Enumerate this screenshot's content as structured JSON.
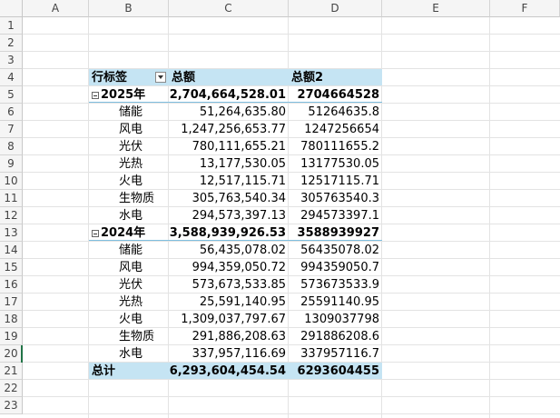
{
  "columns": [
    "A",
    "B",
    "C",
    "D",
    "E",
    "F"
  ],
  "rows": [
    "1",
    "2",
    "3",
    "4",
    "5",
    "6",
    "7",
    "8",
    "9",
    "10",
    "11",
    "12",
    "13",
    "14",
    "15",
    "16",
    "17",
    "18",
    "19",
    "20",
    "21",
    "22",
    "23"
  ],
  "pivot": {
    "header": {
      "label": "行标签",
      "col_c": "总额",
      "col_d": "总额2"
    },
    "groups": [
      {
        "label": "2025年",
        "total_c": "2,704,664,528.01",
        "total_d": "2704664528",
        "items": [
          {
            "label": "储能",
            "c": "51,264,635.80",
            "d": "51264635.8"
          },
          {
            "label": "风电",
            "c": "1,247,256,653.77",
            "d": "1247256654"
          },
          {
            "label": "光伏",
            "c": "780,111,655.21",
            "d": "780111655.2"
          },
          {
            "label": "光热",
            "c": "13,177,530.05",
            "d": "13177530.05"
          },
          {
            "label": "火电",
            "c": "12,517,115.71",
            "d": "12517115.71"
          },
          {
            "label": "生物质",
            "c": "305,763,540.34",
            "d": "305763540.3"
          },
          {
            "label": "水电",
            "c": "294,573,397.13",
            "d": "294573397.1"
          }
        ]
      },
      {
        "label": "2024年",
        "total_c": "3,588,939,926.53",
        "total_d": "3588939927",
        "items": [
          {
            "label": "储能",
            "c": "56,435,078.02",
            "d": "56435078.02"
          },
          {
            "label": "风电",
            "c": "994,359,050.72",
            "d": "994359050.7"
          },
          {
            "label": "光伏",
            "c": "573,673,533.85",
            "d": "573673533.9"
          },
          {
            "label": "光热",
            "c": "25,591,140.95",
            "d": "25591140.95"
          },
          {
            "label": "火电",
            "c": "1,309,037,797.67",
            "d": "1309037798"
          },
          {
            "label": "生物质",
            "c": "291,886,208.63",
            "d": "291886208.6"
          },
          {
            "label": "水电",
            "c": "337,957,116.69",
            "d": "337957116.7"
          }
        ]
      }
    ],
    "grand_total": {
      "label": "总计",
      "c": "6,293,604,454.54",
      "d": "6293604455"
    }
  },
  "colors": {
    "band": "#c5e4f3",
    "selection": "#217346"
  }
}
